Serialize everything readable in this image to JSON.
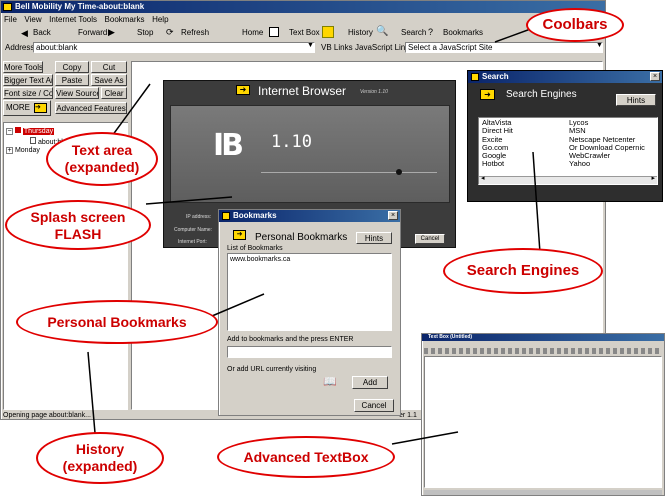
{
  "main_window": {
    "title": "Bell Mobility My Time-about:blank",
    "menu": [
      "File",
      "View",
      "Internet Tools",
      "Bookmarks",
      "Help"
    ],
    "toolbar": {
      "back": "Back",
      "forward": "Forward",
      "stop": "Stop",
      "refresh": "Refresh",
      "home": "Home",
      "textbox": "Text Box",
      "history": "History",
      "search": "Search",
      "bookmarks": "Bookmarks"
    },
    "address_label": "Address",
    "address_value": "about:blank",
    "vb_links": "VB Links",
    "js_links": "JavaScript Links",
    "js_select": "Select a JavaScript Site",
    "tools": {
      "more_tools": "More Tools",
      "copy": "Copy",
      "cut": "Cut",
      "bigger_text": "Bigger Text Area",
      "paste": "Paste",
      "save_as": "Save As",
      "font_size": "Font size / Color",
      "view_source": "View Source",
      "clear": "Clear",
      "more": "MORE",
      "advanced": "Advanced Features"
    },
    "history": {
      "thursday": "Thursday",
      "about_blank": "about:blank",
      "monday": "Monday"
    },
    "status": "Opening page about:blank...",
    "version_tail": "er 1.1"
  },
  "splash": {
    "title": "Internet Browser",
    "version_small": "Version 1.10",
    "logo": "IB",
    "version": "1.10",
    "ip_label": "IP address:",
    "computer_label": "Computer Name:",
    "port_label": "Internet Port:",
    "cancel": "Cancel"
  },
  "search_window": {
    "title": "Search",
    "heading": "Search Engines",
    "hints": "Hints",
    "col1": [
      "AltaVista",
      "Direct Hit",
      "Excite",
      "Go.com",
      "Google",
      "Hotbot"
    ],
    "col2": [
      "Lycos",
      "MSN",
      "Netscape Netcenter",
      "Or Download Copernic",
      "WebCrawler",
      "Yahoo"
    ]
  },
  "bookmarks_window": {
    "title": "Bookmarks",
    "heading": "Personal Bookmarks",
    "hints": "Hints",
    "list_label": "List of Bookmarks",
    "list_items": [
      "www.bookmarks.ca"
    ],
    "add_label": "Add to bookmarks and the press ENTER",
    "add_value": "",
    "or_add_label": "Or add URL currently visiting",
    "add_button": "Add",
    "cancel_button": "Cancel"
  },
  "textbox_window": {
    "title": "Text Box (Untitled)"
  },
  "callouts": {
    "coolbars": "Coolbars",
    "text_area": "Text area\n(expanded)",
    "splash": "Splash screen\nFLASH",
    "search_engines": "Search Engines",
    "personal_bookmarks": "Personal Bookmarks",
    "history": "History\n(expanded)",
    "advanced_textbox": "Advanced TextBox"
  },
  "colors": {
    "callout_red": "#cc0000",
    "title_blue": "#0a246a",
    "win_gray": "#d4d0c8",
    "splash_dark": "#3c3c3c",
    "arrow_yellow": "#ffd700"
  }
}
